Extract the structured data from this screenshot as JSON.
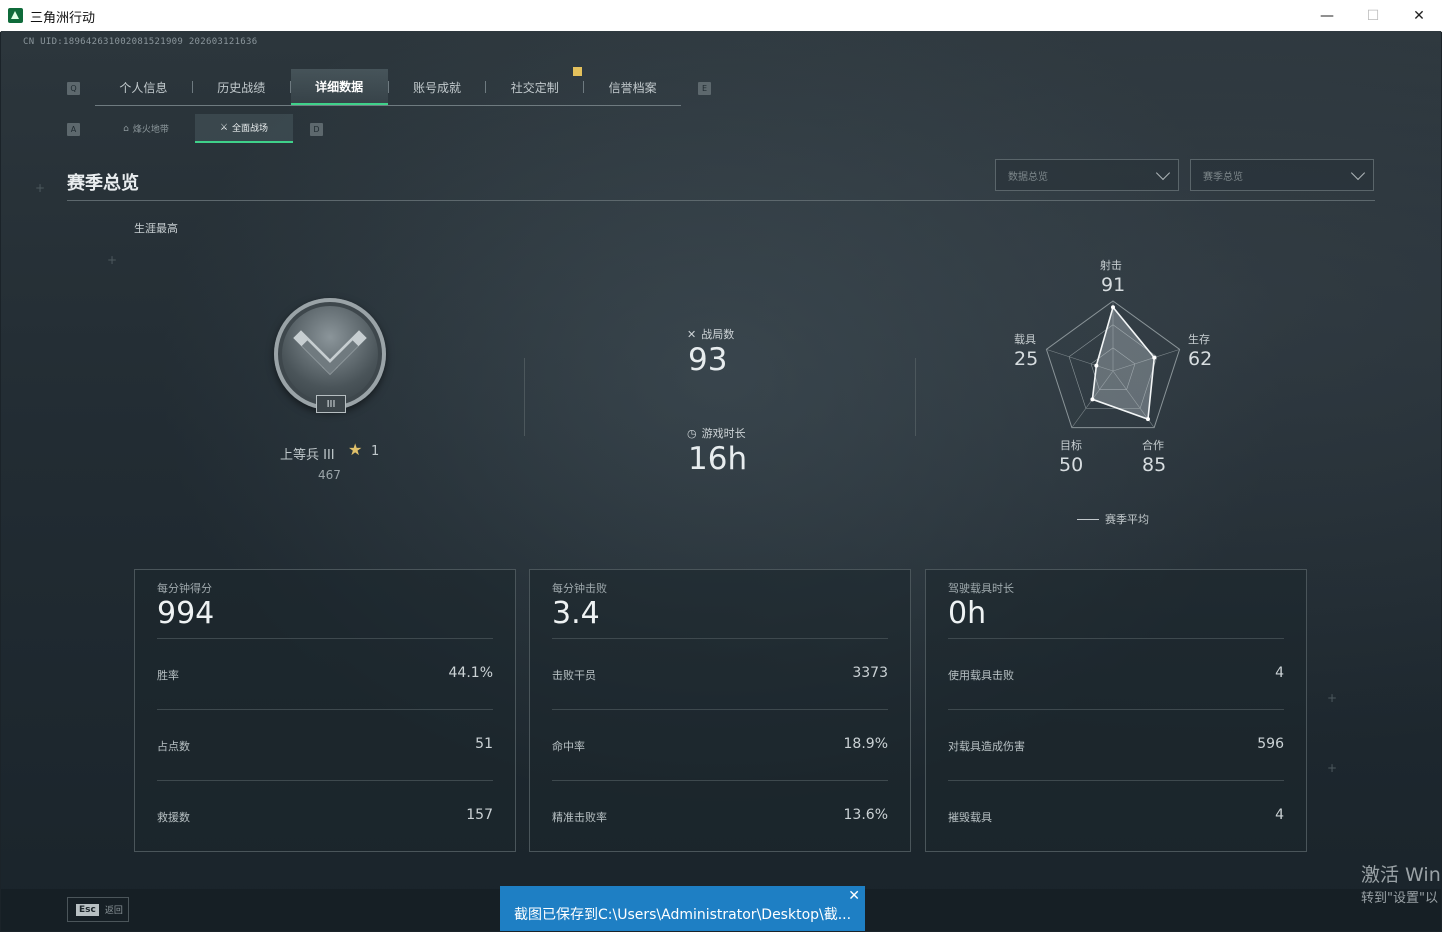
{
  "window": {
    "title": "三角洲行动",
    "minimize": "—",
    "maximize": "☐",
    "close": "✕"
  },
  "uid": "CN UID:1896426310020815219​09 202603121636",
  "nav": {
    "left_key": "Q",
    "right_key": "E",
    "tabs": [
      "个人信息",
      "历史战绩",
      "详细数据",
      "账号成就",
      "社交定制",
      "信誉档案"
    ],
    "active_tab": "详细数据"
  },
  "subnav": {
    "left_key": "A",
    "right_key": "D",
    "tabs": [
      "烽火地带",
      "全面战场"
    ],
    "active_tab": "全面战场"
  },
  "section": {
    "title": "赛季总览",
    "dropdown1": "数据总览",
    "dropdown2": "赛季总览",
    "career_label": "生涯最高"
  },
  "rank": {
    "emblem_numeral": "III",
    "name": "上等兵 III",
    "star_count": "1",
    "points": "467"
  },
  "middle": {
    "matches_label": "战局数",
    "matches_value": "93",
    "playtime_label": "游戏时长",
    "playtime_value": "16h"
  },
  "radar": {
    "axes": [
      {
        "label": "射击",
        "value": 91
      },
      {
        "label": "生存",
        "value": 62
      },
      {
        "label": "合作",
        "value": 85
      },
      {
        "label": "目标",
        "value": 50
      },
      {
        "label": "载具",
        "value": 25
      }
    ],
    "legend": "赛季平均"
  },
  "cards": [
    {
      "head_label": "每分钟得分",
      "head_value": "994",
      "rows": [
        {
          "label": "胜率",
          "value": "44.1%"
        },
        {
          "label": "占点数",
          "value": "51"
        },
        {
          "label": "救援数",
          "value": "157"
        }
      ]
    },
    {
      "head_label": "每分钟击败",
      "head_value": "3.4",
      "rows": [
        {
          "label": "击败干员",
          "value": "3373"
        },
        {
          "label": "命中率",
          "value": "18.9%"
        },
        {
          "label": "精准击败率",
          "value": "13.6%"
        }
      ]
    },
    {
      "head_label": "驾驶载具时长",
      "head_value": "0h",
      "rows": [
        {
          "label": "使用载具击败",
          "value": "4"
        },
        {
          "label": "对载具造成伤害",
          "value": "596"
        },
        {
          "label": "摧毁载具",
          "value": "4"
        }
      ]
    }
  ],
  "footer": {
    "esc_key": "Esc",
    "esc_label": "返回",
    "toast": "截图已保存到C:\\Users\\Administrator\\Desktop\\截...",
    "toast_close": "✕",
    "activate_line1": "激活 Win",
    "activate_line2": "转到\"设置\"以"
  },
  "colors": {
    "accent": "#3fd18a",
    "toast": "#1e7fc4",
    "star": "#e1c16a"
  }
}
